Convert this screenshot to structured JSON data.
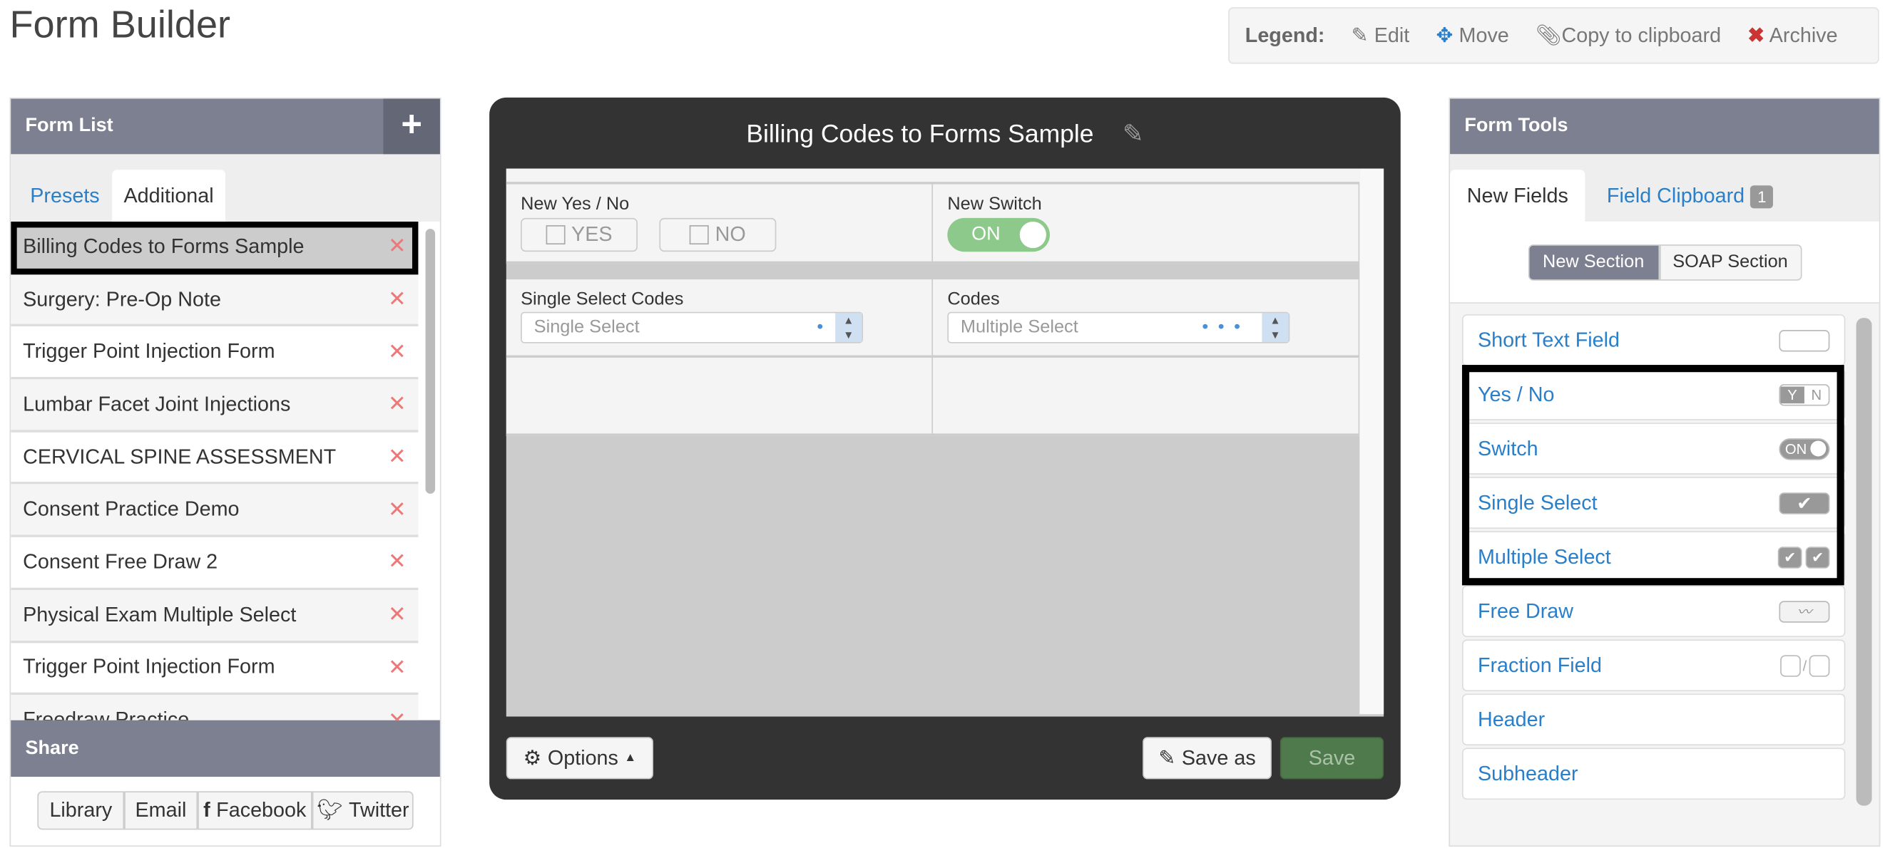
{
  "page_title": "Form Builder",
  "legend": {
    "label": "Legend:",
    "items": [
      {
        "icon": "pencil-icon",
        "label": "Edit"
      },
      {
        "icon": "move-icon",
        "label": "Move"
      },
      {
        "icon": "paperclip-icon",
        "label": "Copy to clipboard"
      },
      {
        "icon": "close-icon",
        "label": "Archive"
      }
    ]
  },
  "form_list": {
    "title": "Form List",
    "tabs": [
      "Presets",
      "Additional"
    ],
    "active_tab": "Additional",
    "items": [
      "Billing Codes to Forms Sample",
      "Surgery: Pre-Op Note",
      "Trigger Point Injection Form",
      "Lumbar Facet Joint Injections",
      "CERVICAL SPINE ASSESSMENT",
      "Consent Practice Demo",
      "Consent Free Draw 2",
      "Physical Exam Multiple Select",
      "Trigger Point Injection Form",
      "Freedraw Practice"
    ],
    "selected": "Billing Codes to Forms Sample"
  },
  "share": {
    "title": "Share",
    "buttons": [
      "Library",
      "Email",
      "Facebook",
      "Twitter"
    ]
  },
  "editor": {
    "title": "Billing Codes to Forms Sample",
    "fields": {
      "yesno_label": "New Yes / No",
      "yes": "YES",
      "no": "NO",
      "switch_label": "New Switch",
      "switch_value": "ON",
      "single_label": "Single Select Codes",
      "single_placeholder": "Single Select",
      "codes_label": "Codes",
      "multi_placeholder": "Multiple Select"
    },
    "options": "Options",
    "save_as": "Save as",
    "save": "Save"
  },
  "form_tools": {
    "title": "Form Tools",
    "tabs": [
      "New Fields",
      "Field Clipboard"
    ],
    "clipboard_count": "1",
    "active_tab": "New Fields",
    "section_buttons": [
      "New Section",
      "SOAP Section"
    ],
    "items": [
      "Short Text Field",
      "Yes / No",
      "Switch",
      "Single Select",
      "Multiple Select",
      "Free Draw",
      "Fraction Field",
      "Header",
      "Subheader"
    ],
    "icons": {
      "yes": "Y",
      "no": "N",
      "on": "ON"
    }
  },
  "colors": {
    "header": "#7d8091",
    "link": "#2a7fca",
    "save": "#4e7a4c",
    "switch": "#8cc98a"
  }
}
